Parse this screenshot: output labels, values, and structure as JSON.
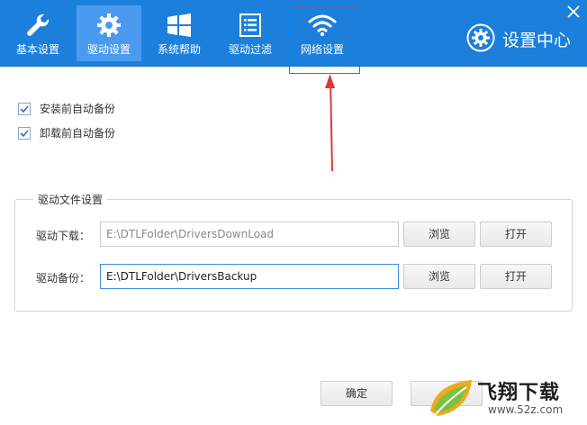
{
  "tabs": [
    {
      "label": "基本设置",
      "icon": "wrench-icon"
    },
    {
      "label": "驱动设置",
      "icon": "gear-icon",
      "active": true
    },
    {
      "label": "系统帮助",
      "icon": "windows-logo-icon"
    },
    {
      "label": "驱动过滤",
      "icon": "list-icon"
    },
    {
      "label": "网络设置",
      "icon": "wifi-icon"
    }
  ],
  "brand": {
    "title": "设置中心",
    "icon": "gear-circle-icon"
  },
  "options": [
    {
      "label": "安装前自动备份",
      "checked": true
    },
    {
      "label": "卸载前自动备份",
      "checked": true
    }
  ],
  "driver_files": {
    "legend": "驱动文件设置",
    "download": {
      "label": "驱动下载：",
      "value": "E:\\DTLFolder\\DriversDownLoad",
      "browse": "浏览",
      "open": "打开"
    },
    "backup": {
      "label": "驱动备份：",
      "value": "E:\\DTLFolder\\DriversBackup",
      "browse": "浏览",
      "open": "打开"
    }
  },
  "footer": {
    "confirm": "确定"
  },
  "watermark": {
    "text": "飞翔下载",
    "url": "www.52z.com"
  },
  "colors": {
    "topbar": "#1c7fdc",
    "active_tab": "#4a9bef",
    "annotation": "#e0373d"
  }
}
